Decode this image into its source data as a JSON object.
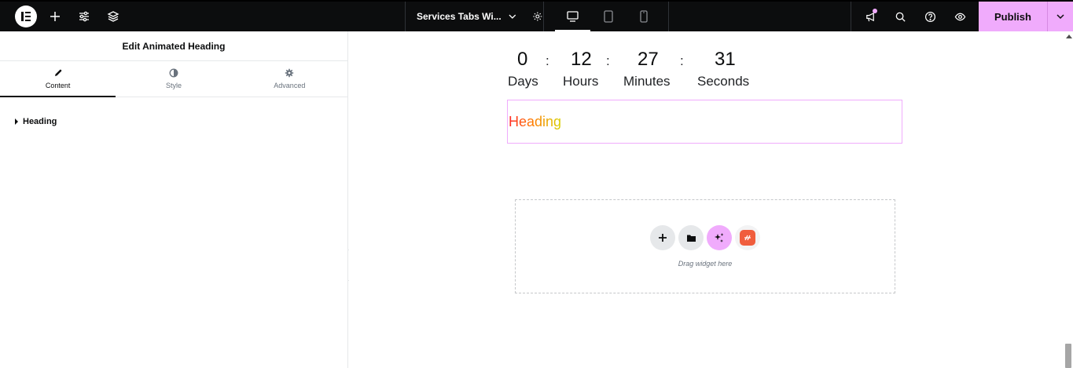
{
  "topbar": {
    "document_title": "Services Tabs Wi...",
    "publish_label": "Publish",
    "accent_color": "#f0abfc"
  },
  "panel": {
    "title": "Edit Animated Heading",
    "tabs": [
      {
        "label": "Content",
        "icon": "pencil-icon",
        "active": true
      },
      {
        "label": "Style",
        "icon": "half-circle-icon",
        "active": false
      },
      {
        "label": "Advanced",
        "icon": "gear-icon",
        "active": false
      }
    ],
    "sections": [
      {
        "label": "Heading",
        "expanded": false
      }
    ]
  },
  "canvas": {
    "countdown": {
      "days_value": "0",
      "days_label": "Days",
      "hours_value": "12",
      "hours_label": "Hours",
      "minutes_value": "27",
      "minutes_label": "Minutes",
      "seconds_value": "31",
      "seconds_label": "Seconds",
      "separator": ":"
    },
    "heading_text": "Heading",
    "drop_zone_label": "Drag widget here"
  }
}
